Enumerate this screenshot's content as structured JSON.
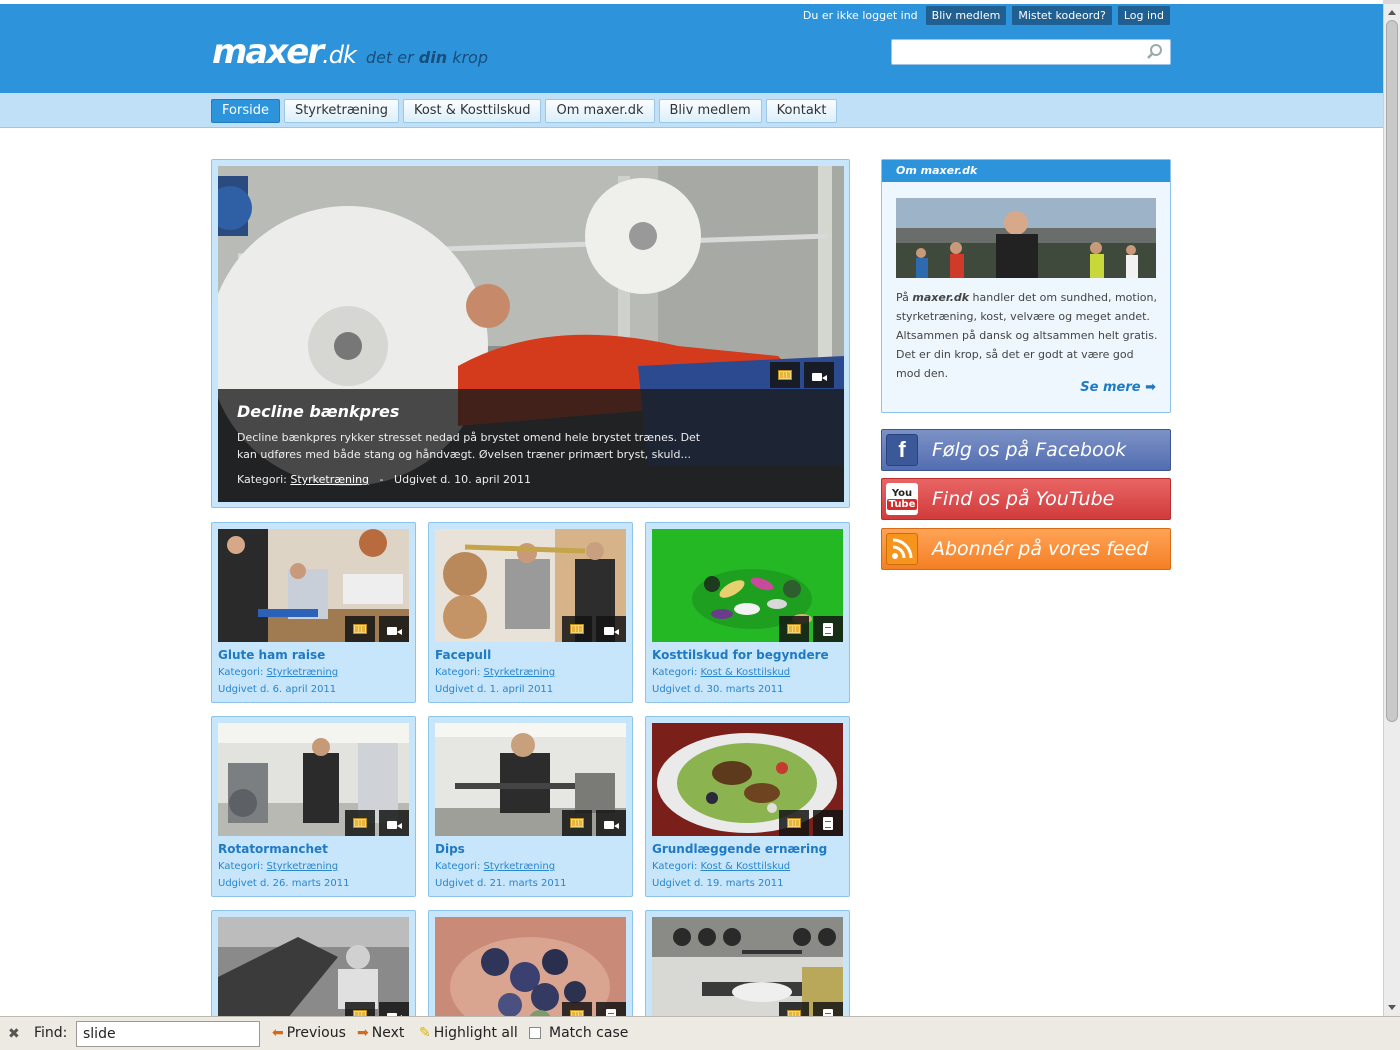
{
  "topbar": {
    "status": "Du er ikke logget ind",
    "buttons": [
      "Bliv medlem",
      "Mistet kodeord?",
      "Log ind"
    ]
  },
  "logo": {
    "main": "maxer",
    "suffix": ".dk",
    "tag_pre": "det er ",
    "tag_bold": "din",
    "tag_post": " krop"
  },
  "nav": {
    "items": [
      "Forside",
      "Styrketræning",
      "Kost & Kosttilskud",
      "Om maxer.dk",
      "Bliv medlem",
      "Kontakt"
    ],
    "active": "Forside"
  },
  "feature": {
    "title": "Decline bænkpres",
    "description": "Decline bænkpres rykker stresset nedad på brystet omend hele brystet trænes. Det kan udføres med både stang og håndvægt. Øvelsen træner primært bryst, skuld...",
    "cat_label": "Kategori:",
    "category": "Styrketræning",
    "sep": "-",
    "date": "Udgivet d. 10. april 2011"
  },
  "cards": [
    {
      "title": "Glute ham raise",
      "cat_label": "Kategori:",
      "category": "Styrketræning",
      "date": "Udgivet d. 6. april 2011",
      "badge": "cam"
    },
    {
      "title": "Facepull",
      "cat_label": "Kategori:",
      "category": "Styrketræning",
      "date": "Udgivet d. 1. april 2011",
      "badge": "cam"
    },
    {
      "title": "Kosttilskud for begyndere",
      "cat_label": "Kategori:",
      "category": "Kost & Kosttilskud",
      "date": "Udgivet d. 30. marts 2011",
      "badge": "doc"
    },
    {
      "title": "Rotatormanchet",
      "cat_label": "Kategori:",
      "category": "Styrketræning",
      "date": "Udgivet d. 26. marts 2011",
      "badge": "cam"
    },
    {
      "title": "Dips",
      "cat_label": "Kategori:",
      "category": "Styrketræning",
      "date": "Udgivet d. 21. marts 2011",
      "badge": "cam"
    },
    {
      "title": "Grundlæggende ernæring",
      "cat_label": "Kategori:",
      "category": "Kost & Kosttilskud",
      "date": "Udgivet d. 19. marts 2011",
      "badge": "doc"
    }
  ],
  "sidebar": {
    "heading": "Om maxer.dk",
    "text_pre": "På ",
    "text_brand": "maxer.dk",
    "text_post": " handler det om sundhed, motion, styrketræning, kost, velvære og meget andet. Altsammen på dansk og altsammen helt gratis. Det er din krop, så det er godt at være god mod den.",
    "more": "Se mere"
  },
  "social": {
    "facebook": "Følg os på Facebook",
    "youtube": "Find os på YouTube",
    "youtube_icon_top": "You",
    "youtube_icon_bottom": "Tube",
    "rss": "Abonnér på vores feed"
  },
  "findbar": {
    "label": "Find:",
    "query": "slide",
    "previous": "Previous",
    "next": "Next",
    "highlight": "Highlight all",
    "match": "Match case"
  },
  "colors": {
    "brand_blue": "#2d94dc",
    "nav_bg": "#bfe0f6",
    "card_bg": "#c7e5fb",
    "link": "#1f7ac4"
  }
}
